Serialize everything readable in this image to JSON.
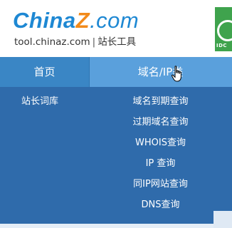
{
  "header": {
    "logo": {
      "china": "China",
      "z": "Z",
      "com": ".com"
    },
    "tagline": {
      "domain": "tool.chinaz.com",
      "separator": "|",
      "name": "站长工具"
    },
    "badge_text": "IDC"
  },
  "nav": {
    "items": [
      {
        "label": "首页"
      },
      {
        "label": "域名/IP类"
      }
    ]
  },
  "submenu": {
    "left": [
      {
        "label": "站长词库"
      }
    ],
    "domain_items": [
      {
        "label": "域名到期查询"
      },
      {
        "label": "过期域名查询"
      },
      {
        "label": "WHOIS查询"
      },
      {
        "label": "IP 查询"
      },
      {
        "label": "同IP网站查询"
      },
      {
        "label": "DNS查询"
      }
    ]
  },
  "colors": {
    "brand_blue": "#1e88d3",
    "brand_orange": "#f28a1a",
    "nav_bg": "#3a86c5",
    "nav_active_bg": "#5aa0dc",
    "menu_bg": "#2f6bab",
    "badge_green": "#3fa34d"
  },
  "icons": {
    "cursor": "hand-pointer-icon"
  }
}
